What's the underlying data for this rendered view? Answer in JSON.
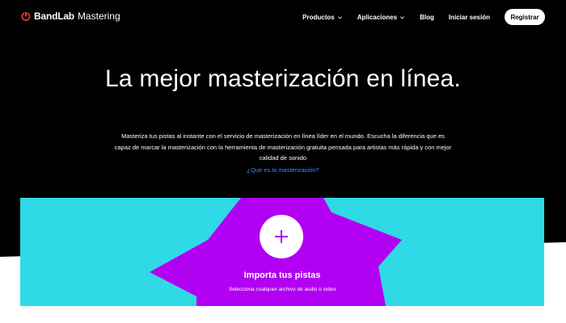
{
  "brand": {
    "name_bold": "BandLab",
    "name_light": "Mastering",
    "icon": "bandlab-logo-icon",
    "accent": "#f2372a"
  },
  "nav": {
    "items": [
      {
        "label": "Productos",
        "has_dropdown": true
      },
      {
        "label": "Aplicaciones",
        "has_dropdown": true
      },
      {
        "label": "Blog",
        "has_dropdown": false
      },
      {
        "label": "Iniciar sesión",
        "has_dropdown": false
      }
    ],
    "register_label": "Registrar"
  },
  "hero": {
    "title": "La mejor masterización en línea.",
    "description": "Masteriza tus pistas al instante con el servicio de masterización en línea líder en el mundo. Escucha la diferencia que es capaz de marcar la masterización con la herramienta de masterización gratuita pensada para artistas más rápida y con mejor calidad de sonido",
    "link_label": "¿Qué es la masterización?",
    "link_color": "#3f8cff"
  },
  "upload": {
    "title": "Importa tus pistas",
    "subtitle": "Selecciona cualquier archivo de audio o video",
    "icon": "plus-icon",
    "background_color": "#2fd9e6",
    "shape_color": "#b100f2",
    "plus_color": "#b100f2"
  }
}
